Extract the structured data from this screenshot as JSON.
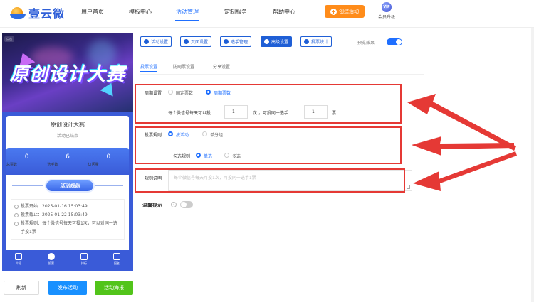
{
  "brand": {
    "name": "壹云微"
  },
  "nav": {
    "items": [
      "用户首页",
      "模板中心",
      "活动管理",
      "定制服务",
      "帮助中心"
    ],
    "create_label": "创建活动",
    "vip_badge": "VIP",
    "vip_label": "会员升级"
  },
  "preview": {
    "tag": "点击",
    "banner_title": "原创设计大赛",
    "activity_name": "原创设计大赛",
    "activity_state": "活动已结束",
    "stats": [
      {
        "num": "0",
        "label": "总票数"
      },
      {
        "num": "6",
        "label": "选手数"
      },
      {
        "num": "0",
        "label": "访问量"
      }
    ],
    "rule_pill": "活动规则",
    "info": [
      "投票开始：2025-01-16 15:03:49",
      "投票截止：2025-01-22 15:03:49",
      "投票规则：每个微信号每天可投1次，可以对同一选手投1票"
    ],
    "tabs": [
      "介绍",
      "投票",
      "排行",
      "报名"
    ]
  },
  "actions": {
    "refresh": "刷新",
    "publish": "发布活动",
    "poster": "活动海报"
  },
  "tool_tabs": [
    "活动设置",
    "页面设置",
    "选手管理",
    "高级设置",
    "投票统计"
  ],
  "preview_effect": "预览效果",
  "sub_tabs": [
    "投票设置",
    "防刷票设置",
    "分享设置"
  ],
  "settings": {
    "period_label": "周期设置",
    "period_fixed": "固定票数",
    "period_cycle": "周期票数",
    "per_day_prefix": "每个微信号每天可以投",
    "per_day_value": "1",
    "per_day_mid": "次 ，可投同一选手",
    "same_value": "1",
    "per_day_suffix": "票",
    "rule_label": "投票规则",
    "rule_activity": "按活动",
    "rule_group": "单分组",
    "check_label": "勾选规则",
    "check_single": "单选",
    "check_multi": "多选",
    "desc_label": "规则说明",
    "desc_placeholder": "每个微信号每天可投1次，可投同一选手1票",
    "warm_tip": "温馨提示"
  },
  "colors": {
    "accent": "#1f6fff",
    "create": "#ff8c1a",
    "highlight": "#e53935",
    "publish": "#1890ff",
    "poster": "#52c41a"
  }
}
